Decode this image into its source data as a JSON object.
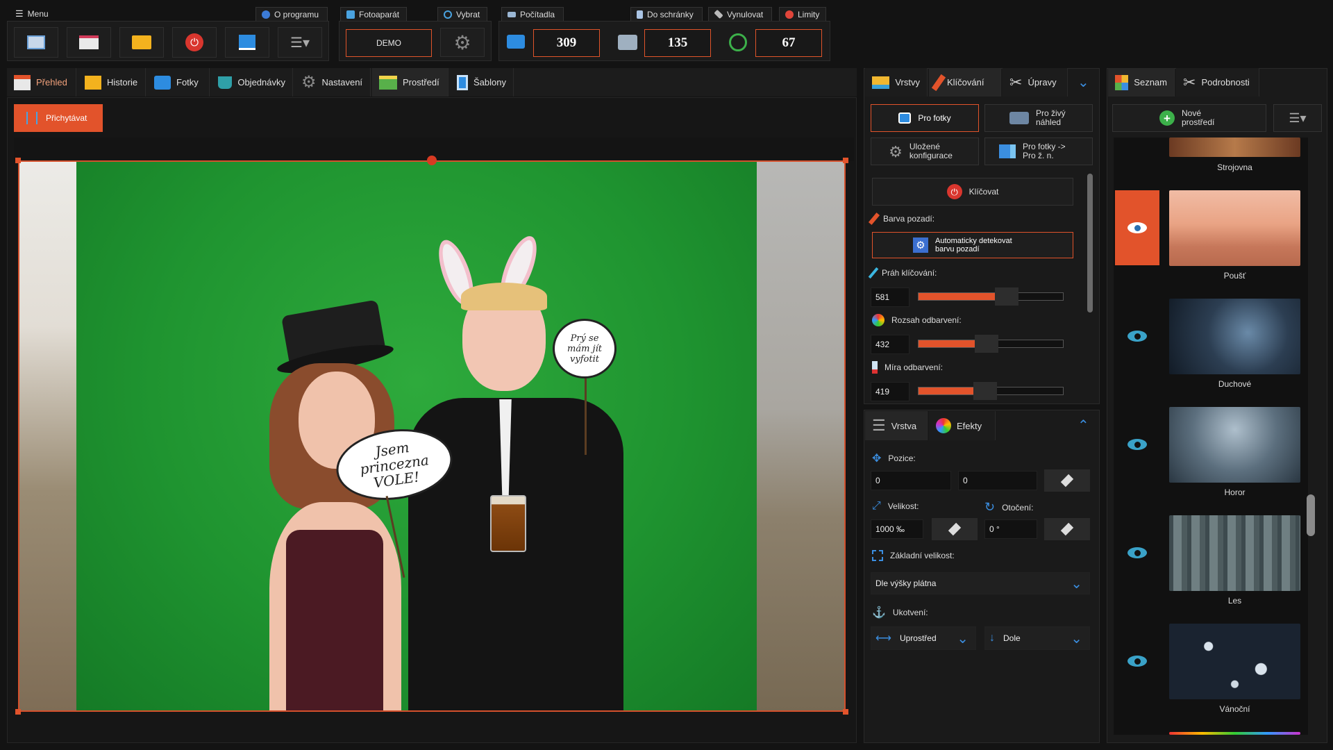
{
  "top_tabs": {
    "menu": "Menu",
    "about": "O programu",
    "camera": "Fotoaparát",
    "select": "Vybrat",
    "counters": "Počítadla",
    "clipboard": "Do schránky",
    "reset": "Vynulovat",
    "limits": "Limity"
  },
  "camera": {
    "mode": "DEMO"
  },
  "counters": {
    "photos": "309",
    "prints": "135",
    "remaining": "67"
  },
  "nav_tabs": [
    {
      "label": "Přehled"
    },
    {
      "label": "Historie"
    },
    {
      "label": "Fotky"
    },
    {
      "label": "Objednávky"
    },
    {
      "label": "Nastavení"
    },
    {
      "label": "Prostředí"
    },
    {
      "label": "Šablony"
    }
  ],
  "toolbar": {
    "snap_label": "Přichytávat"
  },
  "canvas": {
    "sign_left": "Jsem princezna VOLE!",
    "sign_right": "Prý se mám jít vyfotit"
  },
  "layers_panel": {
    "tabs": {
      "layers": "Vrstvy",
      "keying": "Klíčování",
      "edits": "Úpravy"
    },
    "for_photos": "Pro fotky",
    "live_preview": "Pro živý náhled",
    "saved_configs": "Uložené konfigurace",
    "photos_to_live": "Pro fotky -> Pro ž. n.",
    "keying_toggle": "Klíčovat",
    "bg_color_label": "Barva pozadí:",
    "auto_detect": "Automaticky detekovat barvu pozadí",
    "threshold_label": "Práh klíčování:",
    "threshold_value": "581",
    "threshold_fraction": 0.55,
    "decolor_range_label": "Rozsah odbarvení:",
    "decolor_range_value": "432",
    "decolor_range_fraction": 0.41,
    "decolor_amount_label": "Míra odbarvení:",
    "decolor_amount_value": "419",
    "decolor_amount_fraction": 0.4
  },
  "layer_props": {
    "tabs": {
      "layer": "Vrstva",
      "effects": "Efekty"
    },
    "position_label": "Pozice:",
    "pos_x": "0",
    "pos_y": "0",
    "size_label": "Velikost:",
    "size_value": "1000 ‰",
    "rotation_label": "Otočení:",
    "rotation_value": "0 °",
    "base_size_label": "Základní velikost:",
    "base_size_value": "Dle výšky plátna",
    "anchor_label": "Ukotvení:",
    "anchor_h": "Uprostřed",
    "anchor_v": "Dole"
  },
  "environments": {
    "tabs": {
      "list": "Seznam",
      "details": "Podrobnosti"
    },
    "new_button": "Nové prostředí",
    "items": [
      {
        "name": "Strojovna"
      },
      {
        "name": "Poušť"
      },
      {
        "name": "Duchové"
      },
      {
        "name": "Horor"
      },
      {
        "name": "Les"
      },
      {
        "name": "Vánoční"
      }
    ]
  },
  "colors": {
    "accent": "#e2532b",
    "green_screen": "#1f9a32"
  }
}
